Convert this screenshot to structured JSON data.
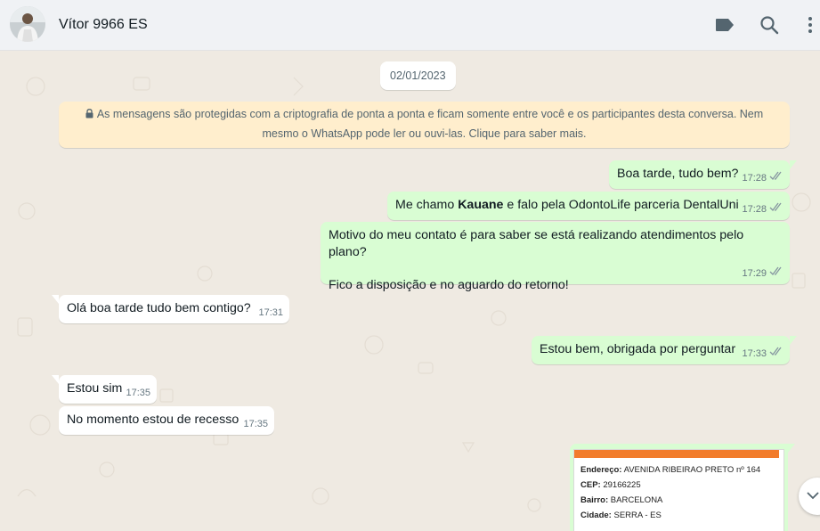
{
  "header": {
    "contact_name": "Vítor 9966 ES",
    "icons": [
      "label-icon",
      "search-icon",
      "menu-icon"
    ]
  },
  "chat": {
    "date_chip": "02/01/2023",
    "encryption_notice": {
      "line1": "As mensagens são protegidas com a criptografia de ponta a ponta e ficam somente entre você e os participantes desta conversa. Nem",
      "line2": "mesmo o WhatsApp pode ler ou ouvi-las. Clique para saber mais."
    },
    "messages": [
      {
        "dir": "out",
        "text": "Boa tarde, tudo bem?",
        "time": "17:28"
      },
      {
        "dir": "out",
        "pre": "Me chamo ",
        "bold": "Kauane",
        "post": " e falo pela OdontoLife parceria DentalUni",
        "time": "17:28"
      },
      {
        "dir": "out",
        "line1": "Motivo do meu contato é para saber se está realizando atendimentos pelo plano?",
        "line2": "Fico a disposição e no aguardo do retorno!",
        "time": "17:29"
      },
      {
        "dir": "in",
        "text": "Olá boa tarde tudo bem contigo?",
        "time": "17:31"
      },
      {
        "dir": "out",
        "text": "Estou bem, obrigada por perguntar",
        "time": "17:33"
      },
      {
        "dir": "in",
        "text": "Estou sim",
        "time": "17:35"
      },
      {
        "dir": "in",
        "text": "No momento estou de recesso",
        "time": "17:35"
      }
    ],
    "document_preview": {
      "endereco_label": "Endereço:",
      "endereco_value": "AVENIDA RIBEIRAO PRETO nº 164",
      "cep_label": "CEP:",
      "cep_value": "29166225",
      "bairro_label": "Bairro:",
      "bairro_value": "BARCELONA",
      "cidade_label": "Cidade:",
      "cidade_value": "SERRA - ES"
    }
  },
  "colors": {
    "outgoing_bubble": "#d9fdd3",
    "incoming_bubble": "#ffffff",
    "chat_background": "#efeae2",
    "notice_background": "#ffeecd",
    "read_ticks": "#8696a0"
  }
}
